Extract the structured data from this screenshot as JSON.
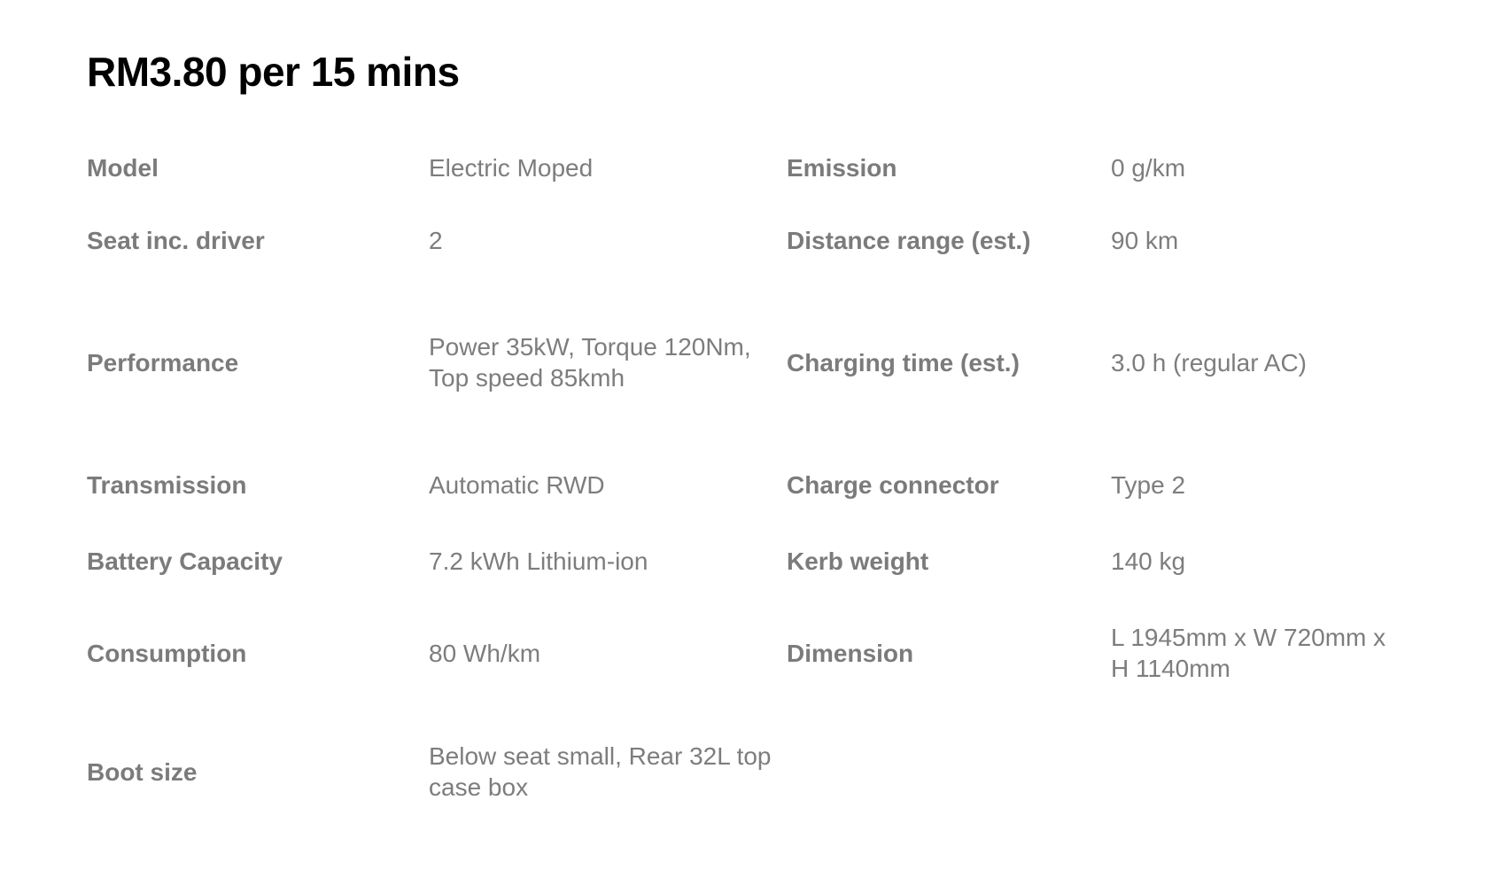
{
  "title": "RM3.80 per 15 mins",
  "rows": [
    {
      "label_left": "Model",
      "value_left": "Electric Moped",
      "label_right": "Emission",
      "value_right": "0 g/km"
    },
    {
      "label_left": "Seat inc. driver",
      "value_left": "2",
      "label_right": "Distance range (est.)",
      "value_right": "90 km"
    },
    {
      "label_left": "Performance",
      "value_left": "Power 35kW, Torque 120Nm, Top speed 85kmh",
      "label_right": "Charging time (est.)",
      "value_right": "3.0 h (regular AC)"
    },
    {
      "label_left": "Transmission",
      "value_left": "Automatic RWD",
      "label_right": "Charge connector",
      "value_right": "Type 2"
    },
    {
      "label_left": "Battery Capacity",
      "value_left": "7.2 kWh Lithium-ion",
      "label_right": "Kerb weight",
      "value_right": "140 kg"
    },
    {
      "label_left": "Consumption",
      "value_left": "80 Wh/km",
      "label_right": "Dimension",
      "value_right": "L 1945mm x W 720mm x H 1140mm"
    },
    {
      "label_left": "Boot size",
      "value_left": "Below seat small, Rear 32L top case box",
      "label_right": "",
      "value_right": ""
    }
  ]
}
